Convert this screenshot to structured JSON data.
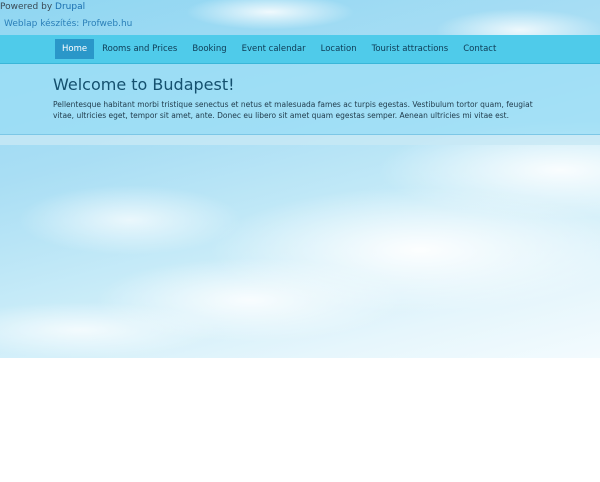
{
  "header": {
    "powered_prefix": "Powered by ",
    "powered_link": "Drupal",
    "weblap": "Weblap készítés: Profweb.hu"
  },
  "nav": {
    "items": [
      {
        "label": "Home",
        "active": true
      },
      {
        "label": "Rooms and Prices"
      },
      {
        "label": "Booking"
      },
      {
        "label": "Event calendar"
      },
      {
        "label": "Location"
      },
      {
        "label": "Tourist attractions"
      },
      {
        "label": "Contact"
      }
    ]
  },
  "hero": {
    "title": "Welcome to Budapest!",
    "text": "Pellentesque habitant morbi tristique senectus et netus et malesuada fames ac turpis egestas. Vestibulum tortor quam, feugiat vitae, ultricies eget, tempor sit amet, ante. Donec eu libero sit amet quam egestas semper. Aenean ultricies mi vitae est."
  },
  "colors": {
    "navbar": "#4fcbea",
    "active_tab": "#2a97c9",
    "sky": "#8fd6f2"
  }
}
